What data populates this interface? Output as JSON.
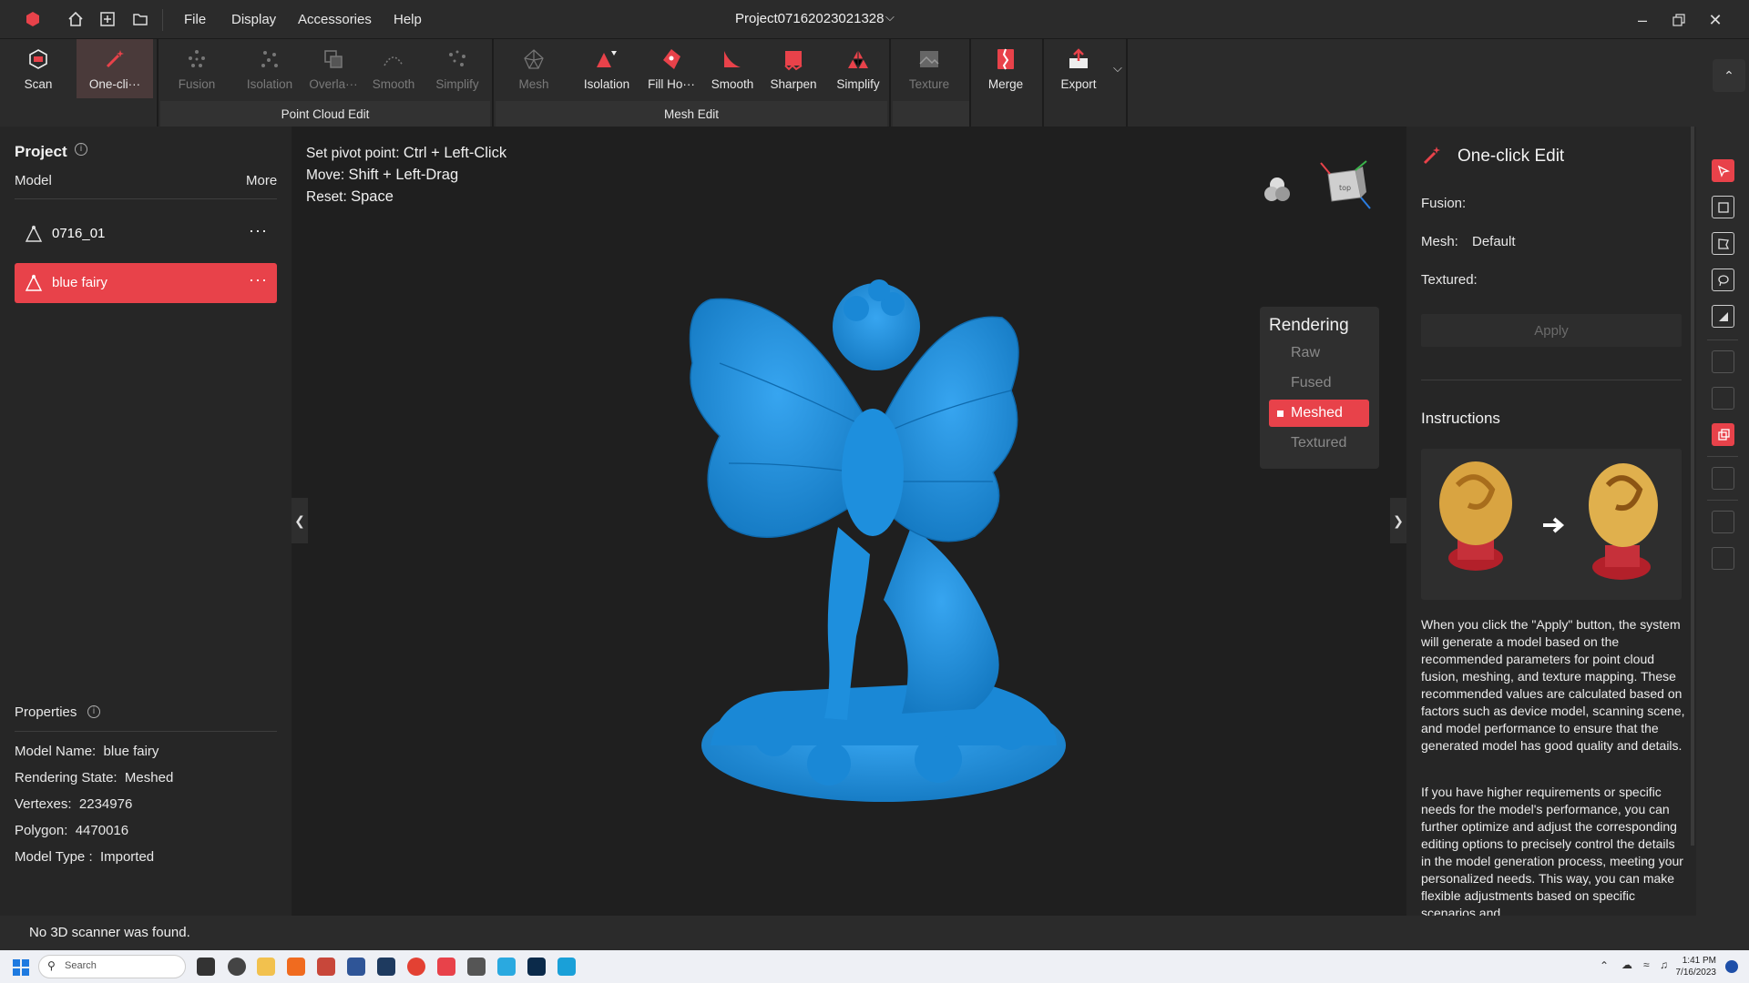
{
  "titlebar": {
    "menu": [
      "File",
      "Display",
      "Accessories",
      "Help"
    ],
    "project_title": "Project07162023021328"
  },
  "toolbar": {
    "tools": {
      "scan": "Scan",
      "oneclick": "One-cli···",
      "fusion": "Fusion",
      "pc_isolation": "Isolation",
      "overlap": "Overla···",
      "pc_smooth": "Smooth",
      "pc_simplify": "Simplify",
      "mesh": "Mesh",
      "mesh_isolation": "Isolation",
      "fill_holes": "Fill Ho···",
      "mesh_smooth": "Smooth",
      "sharpen": "Sharpen",
      "mesh_simplify": "Simplify",
      "texture": "Texture",
      "merge": "Merge",
      "export": "Export"
    },
    "groups": {
      "point_cloud": "Point Cloud Edit",
      "mesh": "Mesh Edit"
    }
  },
  "left_panel": {
    "project_title": "Project",
    "model_label": "Model",
    "more_label": "More",
    "models": [
      {
        "name": "0716_01",
        "more": "···"
      },
      {
        "name": "blue fairy",
        "more": "···"
      }
    ],
    "properties_title": "Properties",
    "properties": [
      {
        "label": "Model Name:",
        "value": "blue fairy"
      },
      {
        "label": "Rendering State:",
        "value": "Meshed"
      },
      {
        "label": "Vertexes:",
        "value": "2234976"
      },
      {
        "label": "Polygon:",
        "value": "4470016"
      },
      {
        "label": "Model Type :",
        "value": "Imported"
      }
    ]
  },
  "viewport": {
    "hints": [
      {
        "label": "Set pivot point:",
        "key": "Ctrl + Left-Click"
      },
      {
        "label": "Move:",
        "key": "Shift + Left-Drag"
      },
      {
        "label": "Reset:",
        "key": "Space"
      }
    ],
    "rendering": {
      "title": "Rendering",
      "options": [
        "Raw",
        "Fused",
        "Meshed",
        "Textured"
      ],
      "selected": "Meshed"
    },
    "model_color": "#1e90e0"
  },
  "right_panel": {
    "title": "One-click Edit",
    "fusion_label": "Fusion:",
    "mesh_label": "Mesh:",
    "mesh_value": "Default",
    "textured_label": "Textured:",
    "apply_label": "Apply",
    "instructions_title": "Instructions",
    "paragraph1": "When you click the \"Apply\" button, the system will generate a model based on the recommended parameters for point cloud fusion, meshing, and texture mapping. These recommended values are calculated based on factors such as device model, scanning scene, and model performance to ensure that the generated model has good quality and details.",
    "paragraph2": "If you have higher requirements or specific needs for the model's performance, you can further optimize and adjust the corresponding editing options to precisely control the details in the model generation process, meeting your personalized needs. This way, you can make flexible adjustments based on specific scenarios and"
  },
  "statusbar": {
    "message": "No 3D scanner was found."
  },
  "taskbar": {
    "search_placeholder": "Search",
    "time": "1:41 PM",
    "date": "7/16/2023"
  },
  "colors": {
    "accent": "#e8424a",
    "panel": "#262626",
    "background": "#1f1f1f"
  }
}
